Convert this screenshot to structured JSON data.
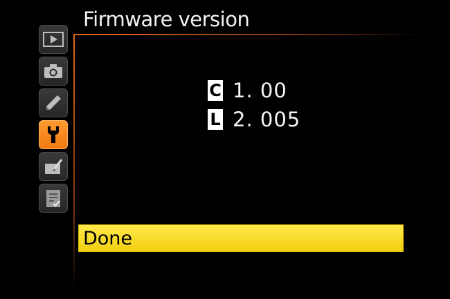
{
  "screen": {
    "title": "Firmware version"
  },
  "sidebar": {
    "tabs": [
      {
        "name": "playback-menu",
        "icon": "playback-icon",
        "active": false
      },
      {
        "name": "shooting-menu",
        "icon": "camera-icon",
        "active": false
      },
      {
        "name": "custom-settings-menu",
        "icon": "pencil-icon",
        "active": false
      },
      {
        "name": "setup-menu",
        "icon": "wrench-icon",
        "active": true
      },
      {
        "name": "retouch-menu",
        "icon": "retouch-icon",
        "active": false
      },
      {
        "name": "my-menu",
        "icon": "my-menu-icon",
        "active": false
      }
    ]
  },
  "firmware": {
    "entries": [
      {
        "badge": "C",
        "version": "1. 00"
      },
      {
        "badge": "L",
        "version": "2. 005"
      }
    ]
  },
  "actions": {
    "done_label": "Done"
  },
  "colors": {
    "accent_orange": "#f07a10",
    "highlight_yellow": "#f2cf10",
    "background": "#000000"
  }
}
